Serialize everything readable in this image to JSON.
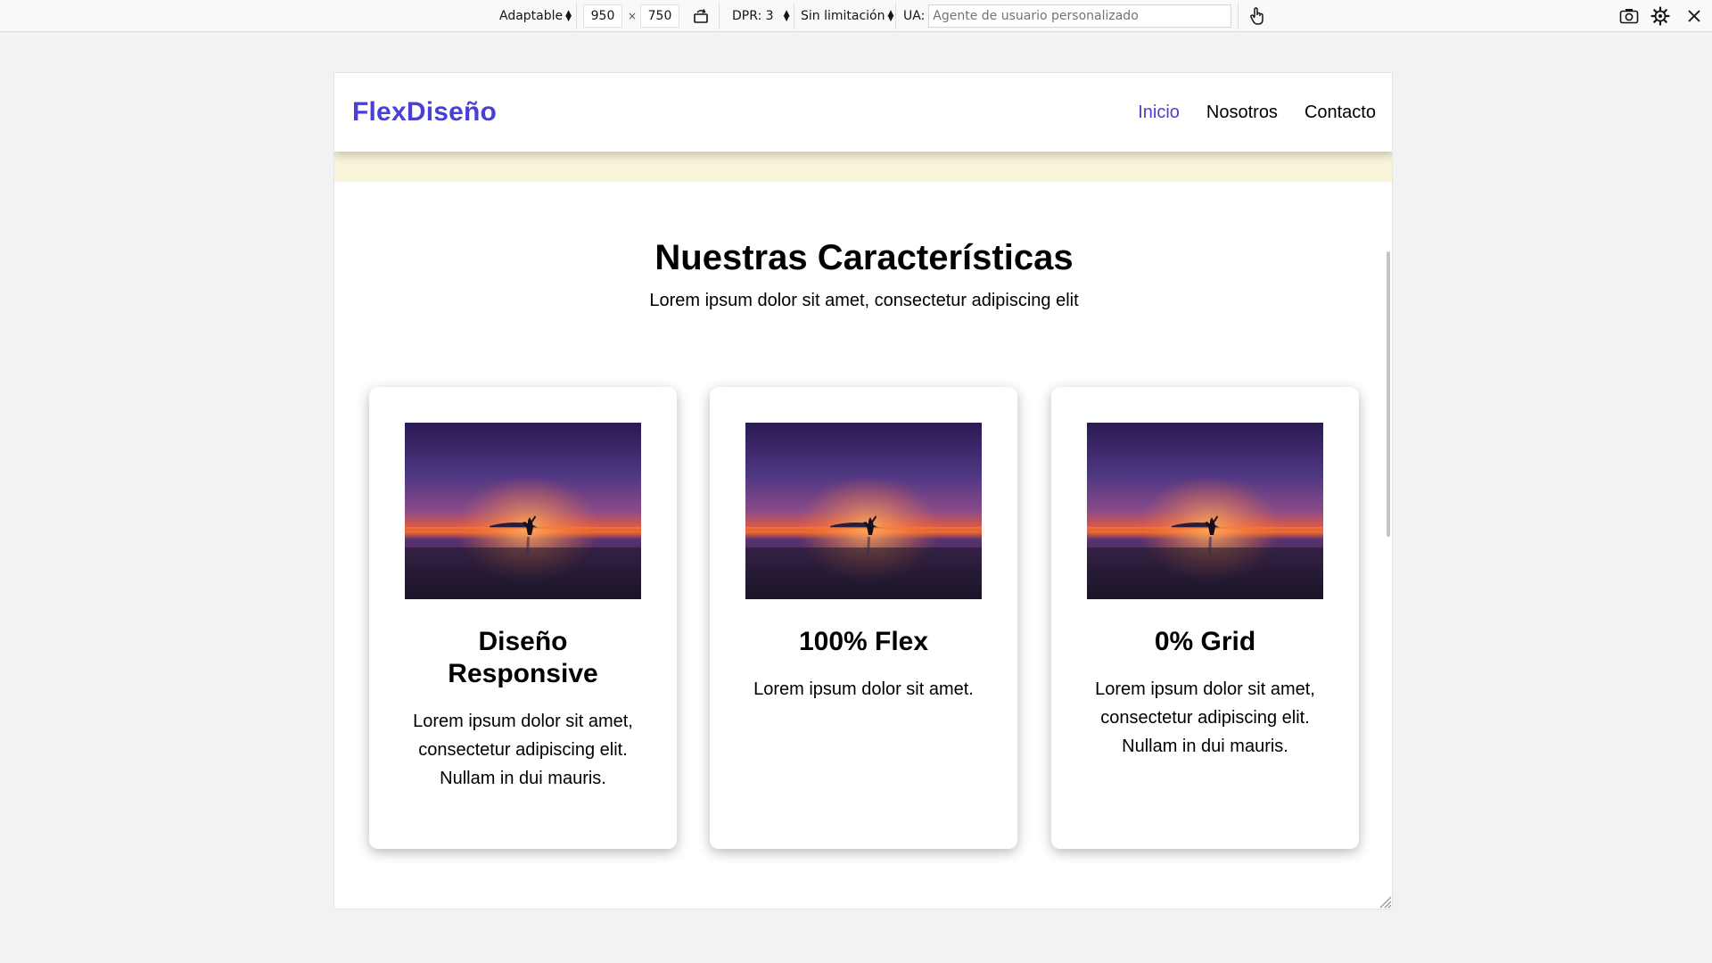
{
  "devtools": {
    "device_label": "Adaptable",
    "width_value": "950",
    "times": "×",
    "height_value": "750",
    "dpr_label": "DPR: 3",
    "throttle_label": "Sin limitación",
    "ua_label": "UA:",
    "ua_placeholder": "Agente de usuario personalizado",
    "icons": [
      "rotate-icon",
      "touch-icon",
      "screenshot-icon",
      "settings-icon",
      "close-icon"
    ]
  },
  "site": {
    "logo": "FlexDiseño",
    "nav": [
      "Inicio",
      "Nosotros",
      "Contacto"
    ],
    "active_nav": "Inicio",
    "heading": "Nuestras Características",
    "subheading": "Lorem ipsum dolor sit amet, consectetur adipiscing elit",
    "cards": [
      {
        "title": "Diseño Responsive",
        "text": "Lorem ipsum dolor sit amet, consectetur adipiscing elit. Nullam in dui mauris."
      },
      {
        "title": "100% Flex",
        "text": "Lorem ipsum dolor sit amet."
      },
      {
        "title": "0% Grid",
        "text": "Lorem ipsum dolor sit amet, consectetur adipiscing elit. Nullam in dui mauris."
      }
    ]
  },
  "colors": {
    "brand": "#4a3fd6",
    "banner": "#f8f5da",
    "page_bg": "#f2f2f2"
  }
}
